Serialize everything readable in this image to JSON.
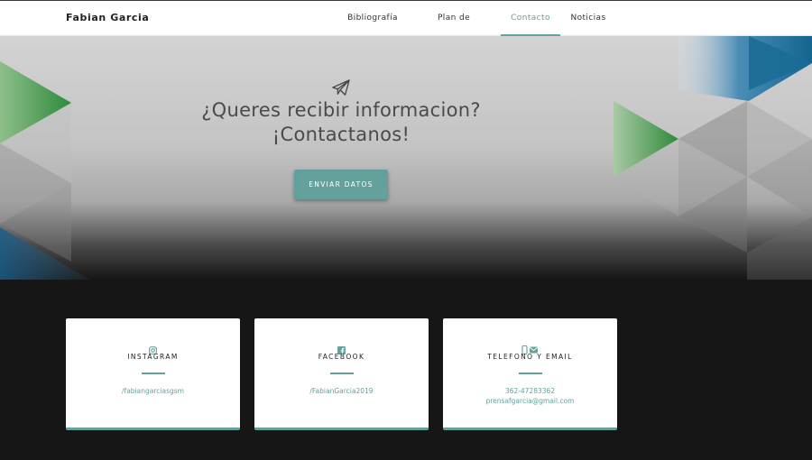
{
  "brand": "Fabian Garcia",
  "nav": {
    "items": [
      {
        "label": "Bibliografía",
        "active": false
      },
      {
        "label": "Plan de Gobierno",
        "active": false
      },
      {
        "label": "Contacto",
        "active": true
      },
      {
        "label": "Noticias",
        "active": false
      }
    ]
  },
  "hero": {
    "icon": "paper-plane-icon",
    "line1": "¿Queres recibir informacion?",
    "line2": "¡Contactanos!",
    "button_label": "ENVIAR DATOS"
  },
  "cards": [
    {
      "icon": "instagram-icon",
      "title": "INSTAGRAM",
      "values": [
        "/fabiangarciasgsm"
      ]
    },
    {
      "icon": "facebook-icon",
      "title": "FACEBOOK",
      "values": [
        "/FabianGarcia2019"
      ]
    },
    {
      "icon": "phone-and-envelope-icon",
      "title": "TELEFONO Y EMAIL",
      "values": [
        "362-47283362",
        "prensafgarcia@gmail.com"
      ]
    }
  ],
  "colors": {
    "accent": "#64a19d",
    "dark": "#161616",
    "text": "#4a4a4a"
  }
}
